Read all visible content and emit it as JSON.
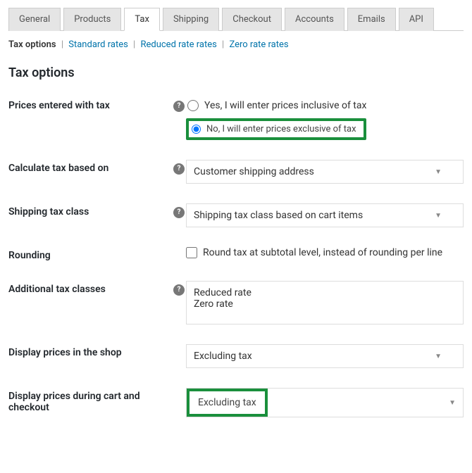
{
  "tabs": {
    "items": [
      {
        "label": "General"
      },
      {
        "label": "Products"
      },
      {
        "label": "Tax"
      },
      {
        "label": "Shipping"
      },
      {
        "label": "Checkout"
      },
      {
        "label": "Accounts"
      },
      {
        "label": "Emails"
      },
      {
        "label": "API"
      }
    ],
    "active_index": 2
  },
  "subnav": {
    "items": [
      {
        "label": "Tax options"
      },
      {
        "label": "Standard rates"
      },
      {
        "label": "Reduced rate rates"
      },
      {
        "label": "Zero rate rates"
      }
    ],
    "active_index": 0
  },
  "section_title": "Tax options",
  "fields": {
    "prices_entered": {
      "label": "Prices entered with tax",
      "opt_yes": "Yes, I will enter prices inclusive of tax",
      "opt_no": "No, I will enter prices exclusive of tax",
      "selected": "no"
    },
    "calc_based_on": {
      "label": "Calculate tax based on",
      "value": "Customer shipping address"
    },
    "shipping_tax_class": {
      "label": "Shipping tax class",
      "value": "Shipping tax class based on cart items"
    },
    "rounding": {
      "label": "Rounding",
      "checkbox_label": "Round tax at subtotal level, instead of rounding per line",
      "checked": false
    },
    "additional_classes": {
      "label": "Additional tax classes",
      "value": "Reduced rate\nZero rate"
    },
    "display_shop": {
      "label": "Display prices in the shop",
      "value": "Excluding tax"
    },
    "display_cart": {
      "label": "Display prices during cart and checkout",
      "value": "Excluding tax"
    }
  },
  "icons": {
    "help_glyph": "?"
  }
}
